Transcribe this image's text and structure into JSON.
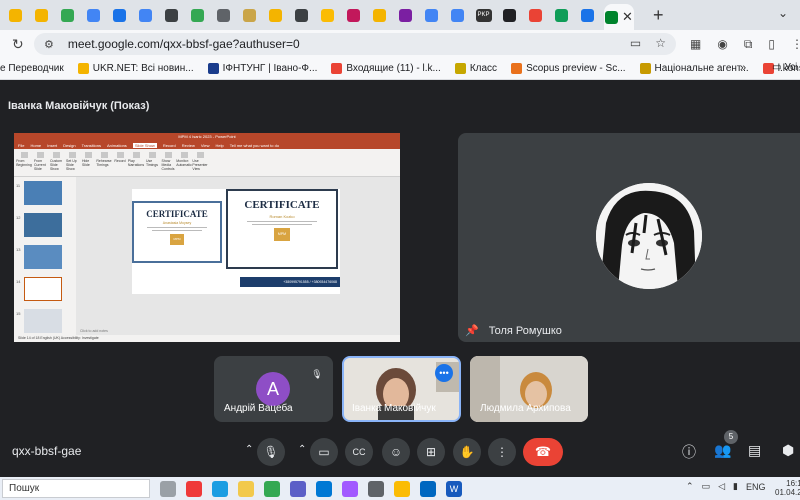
{
  "browser": {
    "active_tab_icon": "google-meet-icon",
    "tabs": [
      {
        "icon": "bookmark-icon",
        "color": "#f4b400"
      },
      {
        "icon": "bookmark-icon",
        "color": "#f4b400"
      },
      {
        "icon": "drive-icon",
        "color": "#34a853"
      },
      {
        "icon": "image-icon",
        "color": "#4285f4"
      },
      {
        "icon": "table-icon",
        "color": "#1a73e8"
      },
      {
        "icon": "docs-icon",
        "color": "#4285f4"
      },
      {
        "icon": "crest-icon",
        "color": "#3c4043"
      },
      {
        "icon": "drive-icon",
        "color": "#34a853"
      },
      {
        "icon": "chrome-icon",
        "color": "#5f6368"
      },
      {
        "icon": "crest-icon",
        "color": "#caa548"
      },
      {
        "icon": "bookmark-icon",
        "color": "#f4b400"
      },
      {
        "icon": "crest-icon",
        "color": "#3c4043"
      },
      {
        "icon": "image-icon",
        "color": "#fbbc04"
      },
      {
        "icon": "crest-icon",
        "color": "#c2185b"
      },
      {
        "icon": "bookmark-icon",
        "color": "#f4b400"
      },
      {
        "icon": "forms-icon",
        "color": "#7b1fa2"
      },
      {
        "icon": "docs-icon",
        "color": "#4285f4"
      },
      {
        "icon": "translate-icon",
        "color": "#4285f4"
      },
      {
        "icon": "pkp-icon",
        "color": "#333333"
      },
      {
        "icon": "openai-icon",
        "color": "#202124"
      },
      {
        "icon": "gmail-icon",
        "color": "#ea4335"
      },
      {
        "icon": "pen-icon",
        "color": "#0f9d58"
      },
      {
        "icon": "calendar-icon",
        "color": "#1a73e8"
      }
    ],
    "pkp_label": "PKP",
    "url": "meet.google.com/qxx-bbsf-gae?authuser=0",
    "bookmarks": [
      {
        "label": "е Переводчик",
        "color": "#4285f4"
      },
      {
        "label": "UKR.NET: Всі новин...",
        "color": "#f4b400"
      },
      {
        "label": "ІФНТУНГ | Івано-Ф...",
        "color": "#1a3c8c"
      },
      {
        "label": "Входящие (11) - l.k...",
        "color": "#ea4335"
      },
      {
        "label": "Класс",
        "color": "#c6a700"
      },
      {
        "label": "Scopus preview - Sc...",
        "color": "#e9711c"
      },
      {
        "label": "Національне агент...",
        "color": "#c79a00"
      },
      {
        "label": "l.konsevich@nung.e...",
        "color": "#ea4335"
      }
    ],
    "all_bookmarks_label": "Усі"
  },
  "meet": {
    "presenter_title": "Іванка Маковійчук (Показ)",
    "pinned_name": "Толя Ромушко",
    "participants": [
      {
        "name": "Андрій Вацеба",
        "initial": "A"
      },
      {
        "name": "Іванка Маковійчук"
      },
      {
        "name": "Людмила Архипова"
      }
    ],
    "meeting_code": "qxx-bbsf-gae",
    "people_count": "5",
    "accent_color": "#1a73e8",
    "hangup_color": "#ea4335"
  },
  "powerpoint": {
    "title": "MPM 4 Isaric 2023 - PowerPoint",
    "menu": [
      "File",
      "Home",
      "Insert",
      "Design",
      "Transitions",
      "Animations",
      "Slide Show",
      "Record",
      "Review",
      "View",
      "Help",
      "Tell me what you want to do"
    ],
    "selected_menu": "Slide Show",
    "ribbon": [
      "From Beginning",
      "From Current Slide",
      "Custom Slide Show",
      "Set Up Slide Show",
      "Hide Slide",
      "Rehearse Timings",
      "Record",
      "Play Narrations",
      "Use Timings",
      "Show Media Controls",
      "Monitor: Automatic",
      "Use Presenter View"
    ],
    "thumb_numbers": [
      "11",
      "12",
      "13",
      "14",
      "15"
    ],
    "cert_title": "CERTIFICATE",
    "cert_name_left": "Anastasia Moysey",
    "cert_name_right": "Roman Kozko",
    "logo_label": "MPM",
    "contact": "+380995791555 / +380934476068",
    "notes_label": "Click to add notes",
    "status": "Slide 14 of 18   English (UK)   Accessibility: Investigate"
  },
  "taskbar": {
    "search_label": "Пошук",
    "lang": "ENG",
    "time": "16:1",
    "date": "01.04.2"
  }
}
